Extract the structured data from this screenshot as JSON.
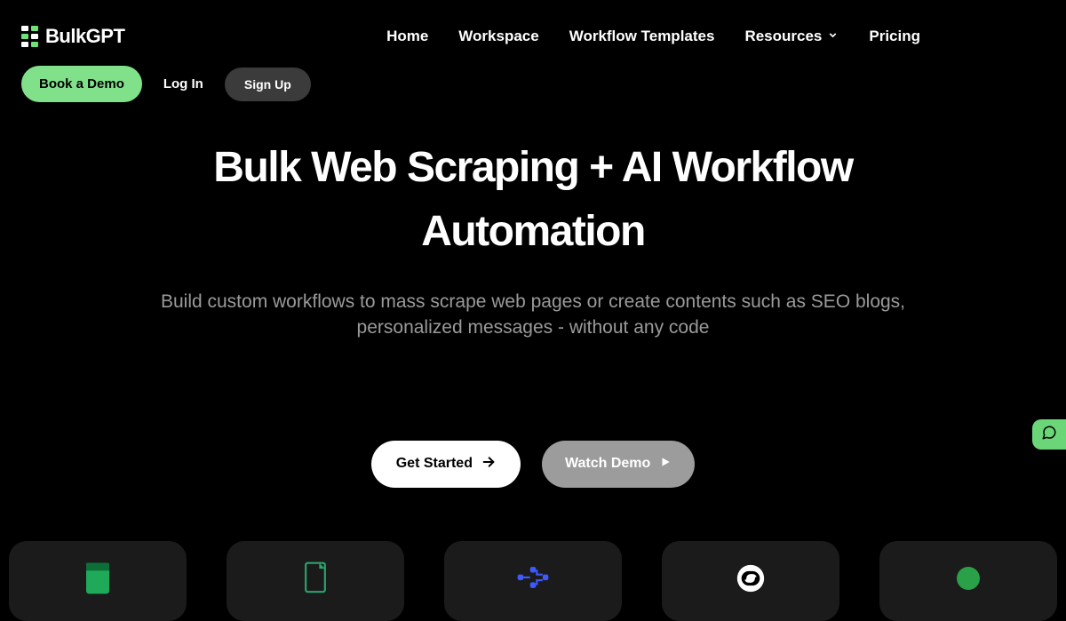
{
  "brand": {
    "name": "BulkGPT"
  },
  "nav": {
    "home": "Home",
    "workspace": "Workspace",
    "templates": "Workflow Templates",
    "resources": "Resources",
    "pricing": "Pricing"
  },
  "actions": {
    "book_demo": "Book a Demo",
    "log_in": "Log In",
    "sign_up": "Sign Up"
  },
  "hero": {
    "title": "Bulk Web Scraping + AI Workflow Automation",
    "subtitle": "Build custom workflows to mass scrape web pages or create contents such as SEO blogs, personalized messages - without any code"
  },
  "cta": {
    "get_started": "Get Started",
    "watch_demo": "Watch Demo"
  },
  "colors": {
    "accent_green": "#81e18b",
    "text_muted": "#9a9a9a",
    "button_gray": "#9c9c9c",
    "tile_bg": "#1b1b1b"
  }
}
